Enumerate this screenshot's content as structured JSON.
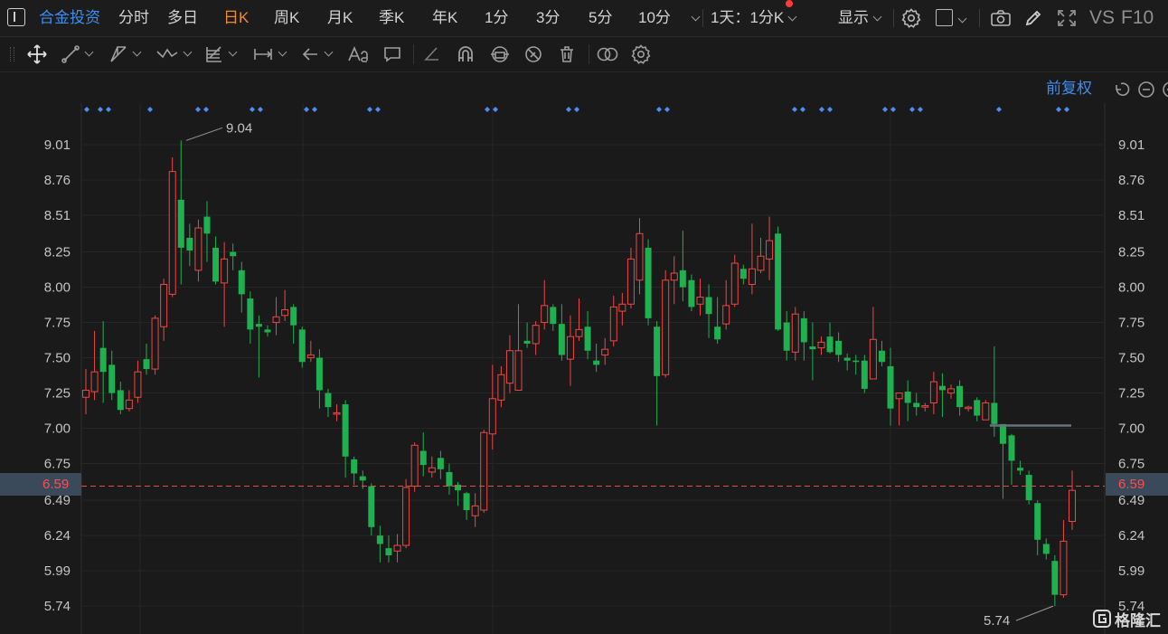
{
  "topbar": {
    "stock_name": "合金投资",
    "periods": [
      "分时",
      "多日",
      "日K",
      "周K",
      "月K",
      "季K",
      "年K",
      "1分",
      "3分",
      "5分",
      "10分"
    ],
    "active_period": "日K",
    "multi_period": "1天：1分K",
    "display_label": "显示",
    "vs_label": "VS",
    "f10_label": "F10"
  },
  "chart_header": {
    "adjust_label": "前复权"
  },
  "chart_data": {
    "type": "candlestick",
    "y_ticks": [
      "9.01",
      "8.76",
      "8.51",
      "8.25",
      "8.00",
      "7.75",
      "7.50",
      "7.25",
      "7.00",
      "6.75",
      "6.49",
      "6.24",
      "5.99",
      "5.74"
    ],
    "y_values": [
      9.01,
      8.76,
      8.51,
      8.25,
      8.0,
      7.75,
      7.5,
      7.25,
      7.0,
      6.75,
      6.49,
      6.24,
      5.99,
      5.74
    ],
    "current_price": "6.59",
    "current_value": 6.59,
    "high_label": "9.04",
    "high_value": 9.04,
    "low_label": "5.74",
    "low_value": 5.74,
    "support_value": 7.02,
    "candles": [
      [
        7.22,
        7.27,
        7.42,
        7.1
      ],
      [
        7.26,
        7.4,
        7.69,
        7.2
      ],
      [
        7.57,
        7.4,
        7.76,
        7.18
      ],
      [
        7.45,
        7.25,
        7.55,
        7.2
      ],
      [
        7.27,
        7.13,
        7.33,
        7.1
      ],
      [
        7.14,
        7.2,
        7.27,
        7.12
      ],
      [
        7.22,
        7.4,
        7.48,
        7.18
      ],
      [
        7.49,
        7.42,
        7.6,
        7.38
      ],
      [
        7.42,
        7.78,
        7.8,
        7.38
      ],
      [
        7.72,
        8.02,
        8.06,
        7.62
      ],
      [
        7.95,
        8.82,
        8.92,
        7.93
      ],
      [
        8.62,
        8.28,
        9.04,
        8.02
      ],
      [
        8.35,
        8.26,
        8.45,
        8.15
      ],
      [
        8.12,
        8.42,
        8.48,
        8.04
      ],
      [
        8.5,
        8.38,
        8.61,
        8.18
      ],
      [
        8.28,
        8.04,
        8.36,
        8.02
      ],
      [
        8.03,
        8.2,
        8.32,
        7.72
      ],
      [
        8.25,
        8.22,
        8.31,
        8.12
      ],
      [
        8.12,
        7.95,
        8.18,
        7.82
      ],
      [
        7.92,
        7.7,
        7.97,
        7.6
      ],
      [
        7.74,
        7.72,
        7.8,
        7.36
      ],
      [
        7.7,
        7.68,
        7.73,
        7.65
      ],
      [
        7.75,
        7.79,
        7.93,
        7.66
      ],
      [
        7.8,
        7.84,
        7.98,
        7.76
      ],
      [
        7.86,
        7.73,
        7.88,
        7.6
      ],
      [
        7.7,
        7.47,
        7.72,
        7.43
      ],
      [
        7.5,
        7.52,
        7.62,
        7.47
      ],
      [
        7.5,
        7.27,
        7.56,
        7.14
      ],
      [
        7.25,
        7.15,
        7.28,
        7.08
      ],
      [
        7.1,
        7.11,
        7.17,
        7.05
      ],
      [
        7.17,
        6.8,
        7.2,
        6.65
      ],
      [
        6.78,
        6.68,
        6.8,
        6.6
      ],
      [
        6.66,
        6.63,
        6.7,
        6.57
      ],
      [
        6.59,
        6.3,
        6.61,
        6.24
      ],
      [
        6.24,
        6.18,
        6.31,
        6.05
      ],
      [
        6.15,
        6.1,
        6.24,
        6.05
      ],
      [
        6.13,
        6.17,
        6.25,
        6.05
      ],
      [
        6.17,
        6.58,
        6.64,
        6.15
      ],
      [
        6.59,
        6.88,
        6.9,
        6.55
      ],
      [
        6.84,
        6.74,
        6.97,
        6.66
      ],
      [
        6.69,
        6.72,
        6.8,
        6.65
      ],
      [
        6.79,
        6.71,
        6.84,
        6.64
      ],
      [
        6.69,
        6.59,
        6.75,
        6.53
      ],
      [
        6.6,
        6.56,
        6.62,
        6.45
      ],
      [
        6.54,
        6.42,
        6.55,
        6.35
      ],
      [
        6.38,
        6.45,
        6.54,
        6.3
      ],
      [
        6.42,
        6.97,
        6.99,
        6.4
      ],
      [
        6.96,
        7.21,
        7.45,
        6.85
      ],
      [
        7.2,
        7.38,
        7.44,
        7.15
      ],
      [
        7.32,
        7.55,
        7.66,
        7.25
      ],
      [
        7.27,
        7.55,
        7.88,
        7.29
      ],
      [
        7.62,
        7.6,
        7.75,
        7.57
      ],
      [
        7.6,
        7.73,
        7.76,
        7.52
      ],
      [
        7.75,
        7.87,
        8.05,
        7.7
      ],
      [
        7.86,
        7.74,
        7.88,
        7.69
      ],
      [
        7.74,
        7.52,
        7.88,
        7.48
      ],
      [
        7.49,
        7.65,
        7.8,
        7.3
      ],
      [
        7.65,
        7.7,
        7.92,
        7.62
      ],
      [
        7.72,
        7.55,
        7.83,
        7.49
      ],
      [
        7.48,
        7.45,
        7.6,
        7.4
      ],
      [
        7.52,
        7.56,
        7.64,
        7.45
      ],
      [
        7.62,
        7.86,
        7.94,
        7.58
      ],
      [
        7.83,
        7.88,
        7.96,
        7.73
      ],
      [
        7.88,
        8.2,
        8.28,
        7.85
      ],
      [
        8.05,
        8.38,
        8.49,
        7.95
      ],
      [
        8.28,
        7.78,
        8.34,
        7.73
      ],
      [
        7.72,
        7.37,
        7.76,
        7.02
      ],
      [
        7.38,
        8.05,
        8.12,
        7.36
      ],
      [
        8.05,
        8.1,
        8.22,
        7.88
      ],
      [
        8.12,
        8.0,
        8.4,
        7.9
      ],
      [
        8.05,
        7.86,
        8.09,
        7.83
      ],
      [
        7.88,
        7.93,
        8.06,
        7.8
      ],
      [
        7.93,
        7.81,
        8.02,
        7.64
      ],
      [
        7.72,
        7.63,
        7.93,
        7.6
      ],
      [
        7.74,
        7.87,
        8.05,
        7.7
      ],
      [
        7.88,
        8.17,
        8.23,
        7.86
      ],
      [
        8.13,
        8.06,
        8.16,
        8.02
      ],
      [
        8.02,
        8.13,
        8.45,
        7.95
      ],
      [
        8.12,
        8.22,
        8.35,
        8.1
      ],
      [
        8.2,
        8.33,
        8.5,
        8.05
      ],
      [
        8.38,
        7.7,
        8.43,
        7.69
      ],
      [
        7.75,
        7.55,
        7.83,
        7.48
      ],
      [
        7.54,
        7.81,
        7.86,
        7.48
      ],
      [
        7.78,
        7.61,
        7.83,
        7.48
      ],
      [
        7.58,
        7.56,
        7.75,
        7.34
      ],
      [
        7.57,
        7.61,
        7.65,
        7.52
      ],
      [
        7.65,
        7.54,
        7.75,
        7.53
      ],
      [
        7.62,
        7.52,
        7.68,
        7.47
      ],
      [
        7.5,
        7.48,
        7.53,
        7.41
      ],
      [
        7.48,
        7.47,
        7.52,
        7.38
      ],
      [
        7.48,
        7.28,
        7.52,
        7.25
      ],
      [
        7.35,
        7.63,
        7.86,
        7.35
      ],
      [
        7.55,
        7.47,
        7.62,
        7.44
      ],
      [
        7.44,
        7.14,
        7.57,
        7.02
      ],
      [
        7.21,
        7.25,
        7.25,
        7.02
      ],
      [
        7.26,
        7.18,
        7.34,
        7.05
      ],
      [
        7.18,
        7.15,
        7.25,
        7.09
      ],
      [
        7.15,
        7.16,
        7.18,
        7.12
      ],
      [
        7.18,
        7.33,
        7.4,
        7.1
      ],
      [
        7.3,
        7.27,
        7.39,
        7.08
      ],
      [
        7.25,
        7.28,
        7.31,
        7.21
      ],
      [
        7.3,
        7.15,
        7.34,
        7.09
      ],
      [
        7.14,
        7.15,
        7.16,
        7.12
      ],
      [
        7.2,
        7.09,
        7.22,
        7.05
      ],
      [
        7.06,
        7.18,
        7.2,
        7.06
      ],
      [
        7.18,
        7.03,
        7.58,
        6.94
      ],
      [
        7.03,
        6.89,
        7.03,
        6.5
      ],
      [
        6.95,
        6.77,
        6.96,
        6.6
      ],
      [
        6.72,
        6.7,
        6.77,
        6.67
      ],
      [
        6.67,
        6.49,
        6.7,
        6.46
      ],
      [
        6.47,
        6.21,
        6.49,
        6.1
      ],
      [
        6.18,
        6.11,
        6.22,
        6.07
      ],
      [
        6.06,
        5.82,
        6.1,
        5.74
      ],
      [
        5.82,
        6.2,
        6.35,
        5.8
      ],
      [
        6.34,
        6.56,
        6.7,
        6.28
      ]
    ],
    "markers_top": [
      96,
      120,
      166,
      228,
      288,
      348,
      418,
      548,
      638,
      738,
      888,
      918,
      988,
      1018,
      1105,
      1180
    ]
  }
}
